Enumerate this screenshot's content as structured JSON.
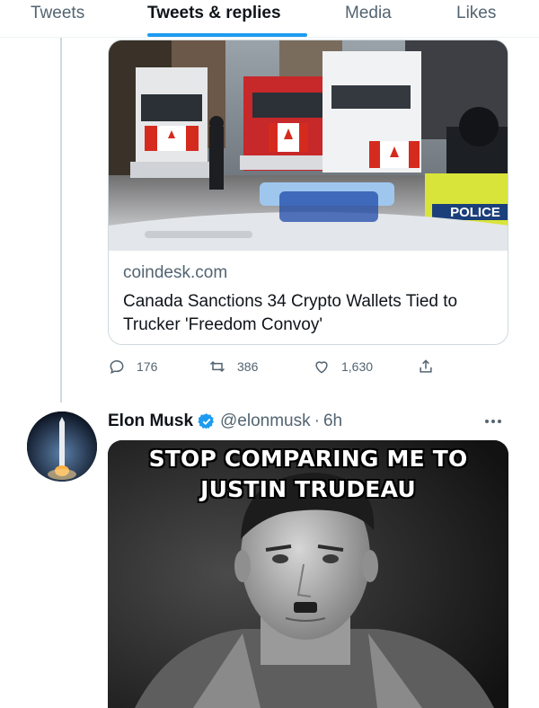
{
  "profile_tabs": [
    {
      "label": "Tweets",
      "active": false
    },
    {
      "label": "Tweets & replies",
      "active": true
    },
    {
      "label": "Media",
      "active": false
    },
    {
      "label": "Likes",
      "active": false
    }
  ],
  "link_card": {
    "domain": "coindesk.com",
    "title": "Canada Sanctions 34 Crypto Wallets Tied to Trucker 'Freedom Convoy'",
    "image_sign": "POLICE"
  },
  "actions": {
    "reply_icon": "reply-icon",
    "reply_count": "176",
    "retweet_icon": "retweet-icon",
    "retweet_count": "386",
    "like_icon": "heart-icon",
    "like_count": "1,630",
    "share_icon": "share-icon"
  },
  "reply_tweet": {
    "author_name": "Elon Musk",
    "handle": "@elonmusk",
    "separator": "·",
    "time": "6h",
    "meme_caption": "STOP COMPARING ME TO JUSTIN TRUDEAU"
  },
  "colors": {
    "accent": "#1d9bf0",
    "secondary_text": "#536471",
    "border": "#cfd9de"
  }
}
